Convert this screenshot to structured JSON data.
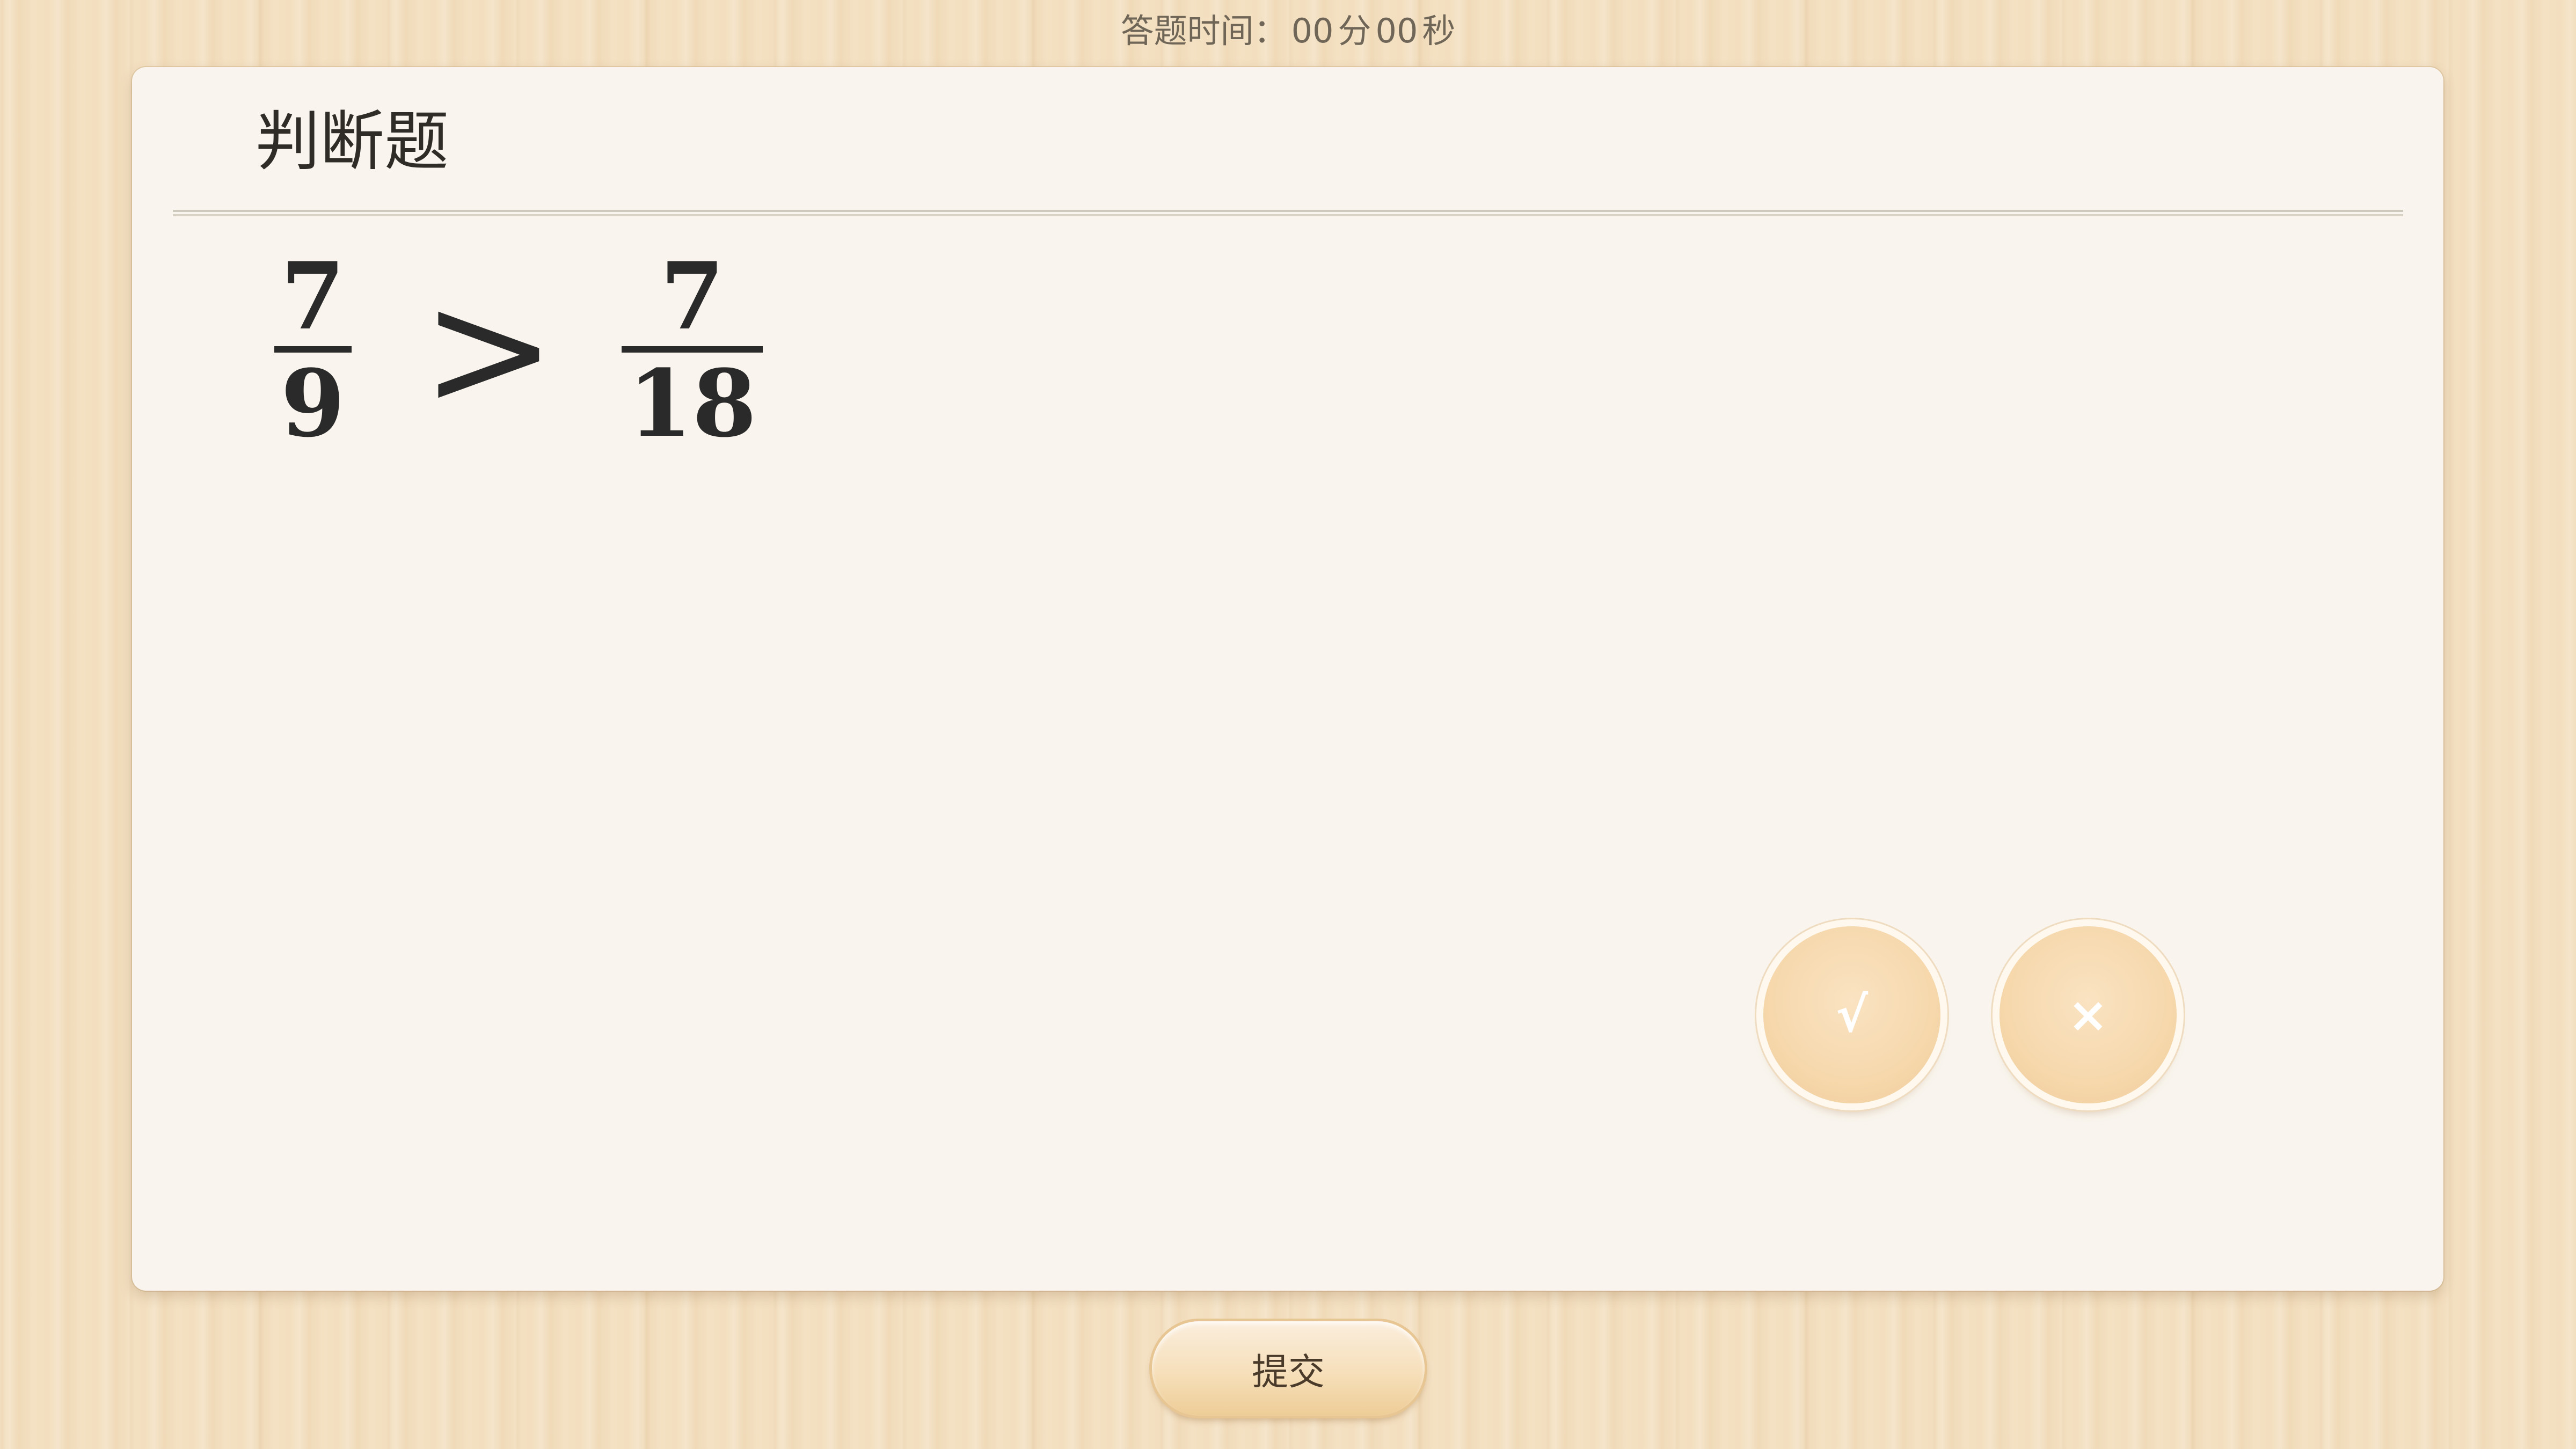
{
  "timer": {
    "label": "答题时间：",
    "minutes": "00",
    "minutes_unit": "分",
    "seconds": "00",
    "seconds_unit": "秒"
  },
  "question": {
    "type_label": "判断题",
    "left_fraction": {
      "numerator": "7",
      "denominator": "9"
    },
    "operator": ">",
    "right_fraction": {
      "numerator": "7",
      "denominator": "18"
    }
  },
  "answers": {
    "true_label": "√",
    "false_label": "×"
  },
  "submit": {
    "label": "提交"
  },
  "colors": {
    "background_wood": "#f3dfbf",
    "card": "#f9f5ee",
    "answer_button": "#f6d8ac",
    "text": "#2f2b27"
  }
}
